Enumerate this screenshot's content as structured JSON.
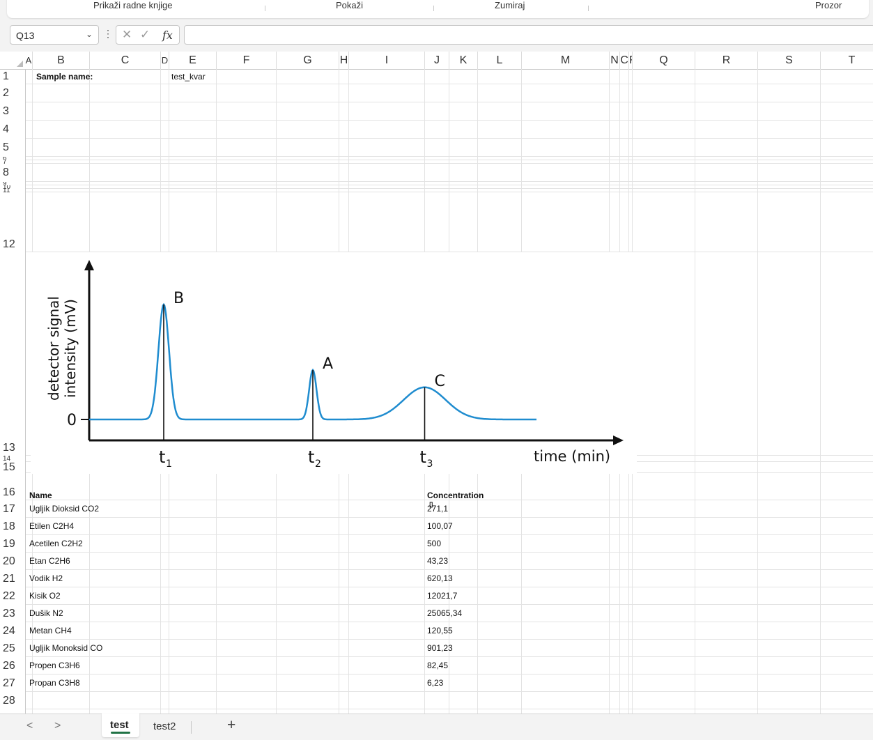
{
  "ribbon": {
    "items": [
      "Prikaži radne knjige",
      "Pokaži",
      "Zumiraj",
      "Prozor"
    ]
  },
  "formula_bar": {
    "name_box": "Q13",
    "formula": ""
  },
  "columns": [
    "A",
    "B",
    "C",
    "D",
    "E",
    "F",
    "G",
    "H",
    "I",
    "J",
    "K",
    "L",
    "M",
    "N",
    "O",
    "P",
    "Q",
    "R",
    "S",
    "T"
  ],
  "column_labels": {
    "N": "N",
    "OP": "CF"
  },
  "rows": [
    "1",
    "2",
    "3",
    "4",
    "5",
    "6",
    "7",
    "8",
    "9",
    "10",
    "11",
    "12",
    "13",
    "14",
    "15",
    "16",
    "17",
    "18",
    "19",
    "20",
    "21",
    "22",
    "23",
    "24",
    "25",
    "26",
    "27",
    "28"
  ],
  "sheet": {
    "sample_label": "Sample name:",
    "sample_value": "test_kvar",
    "table_header_name": "Name",
    "table_header_conc": "Concentration",
    "table_header_unit": "▯",
    "table": [
      {
        "name": "Ugljik Dioksid CO2",
        "value": "271,1"
      },
      {
        "name": "Etilen C2H4",
        "value": "100,07"
      },
      {
        "name": "Acetilen C2H2",
        "value": "500"
      },
      {
        "name": "Etan C2H6",
        "value": "43,23"
      },
      {
        "name": "Vodik H2",
        "value": "620,13"
      },
      {
        "name": "Kisik O2",
        "value": "12021,7"
      },
      {
        "name": "Dušik N2",
        "value": "25065,34"
      },
      {
        "name": "Metan CH4",
        "value": "120,55"
      },
      {
        "name": "Ugljik Monoksid CO",
        "value": "901,23"
      },
      {
        "name": "Propen C3H6",
        "value": "82,45"
      },
      {
        "name": "Propan C3H8",
        "value": "6,23"
      }
    ]
  },
  "chart_data": {
    "type": "line",
    "ylabel_line1": "detector signal",
    "ylabel_line2": "intensity (mV)",
    "xlabel": "time (min)",
    "y_zero_label": "0",
    "peaks": [
      {
        "label": "B",
        "time_label": "t",
        "time_sub": "1",
        "x": 1.0,
        "height": 1.0,
        "width": 0.05
      },
      {
        "label": "A",
        "time_label": "t",
        "time_sub": "2",
        "x": 2.0,
        "height": 0.43,
        "width": 0.035
      },
      {
        "label": "C",
        "time_label": "t",
        "time_sub": "3",
        "x": 2.75,
        "height": 0.28,
        "width": 0.2
      }
    ],
    "x_range": [
      0,
      4
    ],
    "line_color": "#1f8ccf"
  },
  "tabs": {
    "active": "test",
    "other": "test2",
    "add": "+",
    "prev": "<",
    "next": ">"
  }
}
